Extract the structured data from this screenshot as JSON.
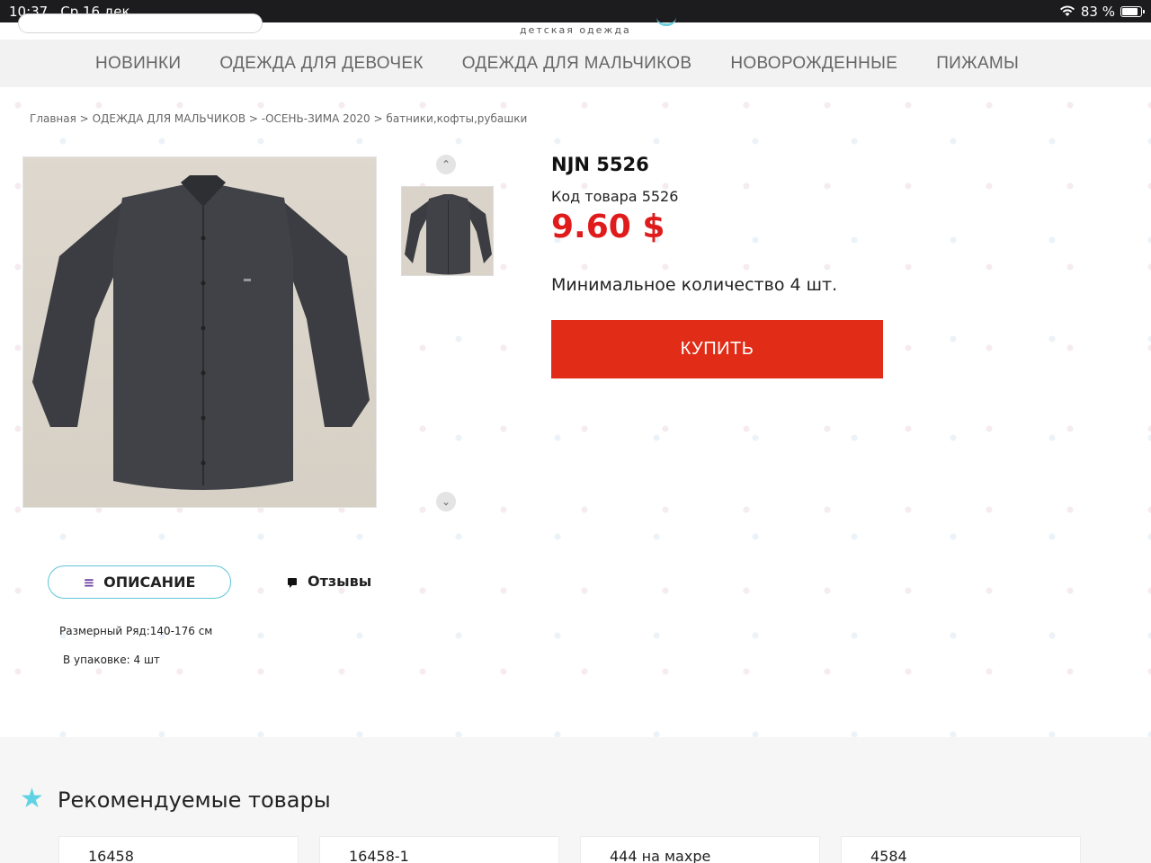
{
  "status_bar": {
    "time": "10:37",
    "date": "Ср 16 дек.",
    "battery": "83 %"
  },
  "header": {
    "logo_subtitle": "детская одежда"
  },
  "nav": {
    "items": [
      "НОВИНКИ",
      "ОДЕЖДА ДЛЯ ДЕВОЧЕК",
      "ОДЕЖДА ДЛЯ МАЛЬЧИКОВ",
      "НОВОРОЖДЕННЫЕ",
      "ПИЖАМЫ"
    ]
  },
  "breadcrumb": {
    "items": [
      "Главная",
      "ОДЕЖДА ДЛЯ МАЛЬЧИКОВ",
      "-ОСЕНЬ-ЗИМА 2020",
      "батники,кофты,рубашки"
    ],
    "separator": ">"
  },
  "product": {
    "title": "NJN 5526",
    "sku": "Код товара 5526",
    "price": "9.60 $",
    "min_qty": "Минимальное количество 4 шт.",
    "buy_label": "КУПИТЬ",
    "accent_color": "#e12d17",
    "price_color": "#e01b1b"
  },
  "tabs": {
    "description": "ОПИСАНИЕ",
    "reviews": "Отзывы"
  },
  "description": {
    "line1": "Размерный Ряд:140-176 см",
    "line2": "В упаковке: 4 шт"
  },
  "recommended": {
    "title": "Рекомендуемые товары",
    "items": [
      "16458",
      "16458-1",
      "444 на махре",
      "4584"
    ]
  }
}
